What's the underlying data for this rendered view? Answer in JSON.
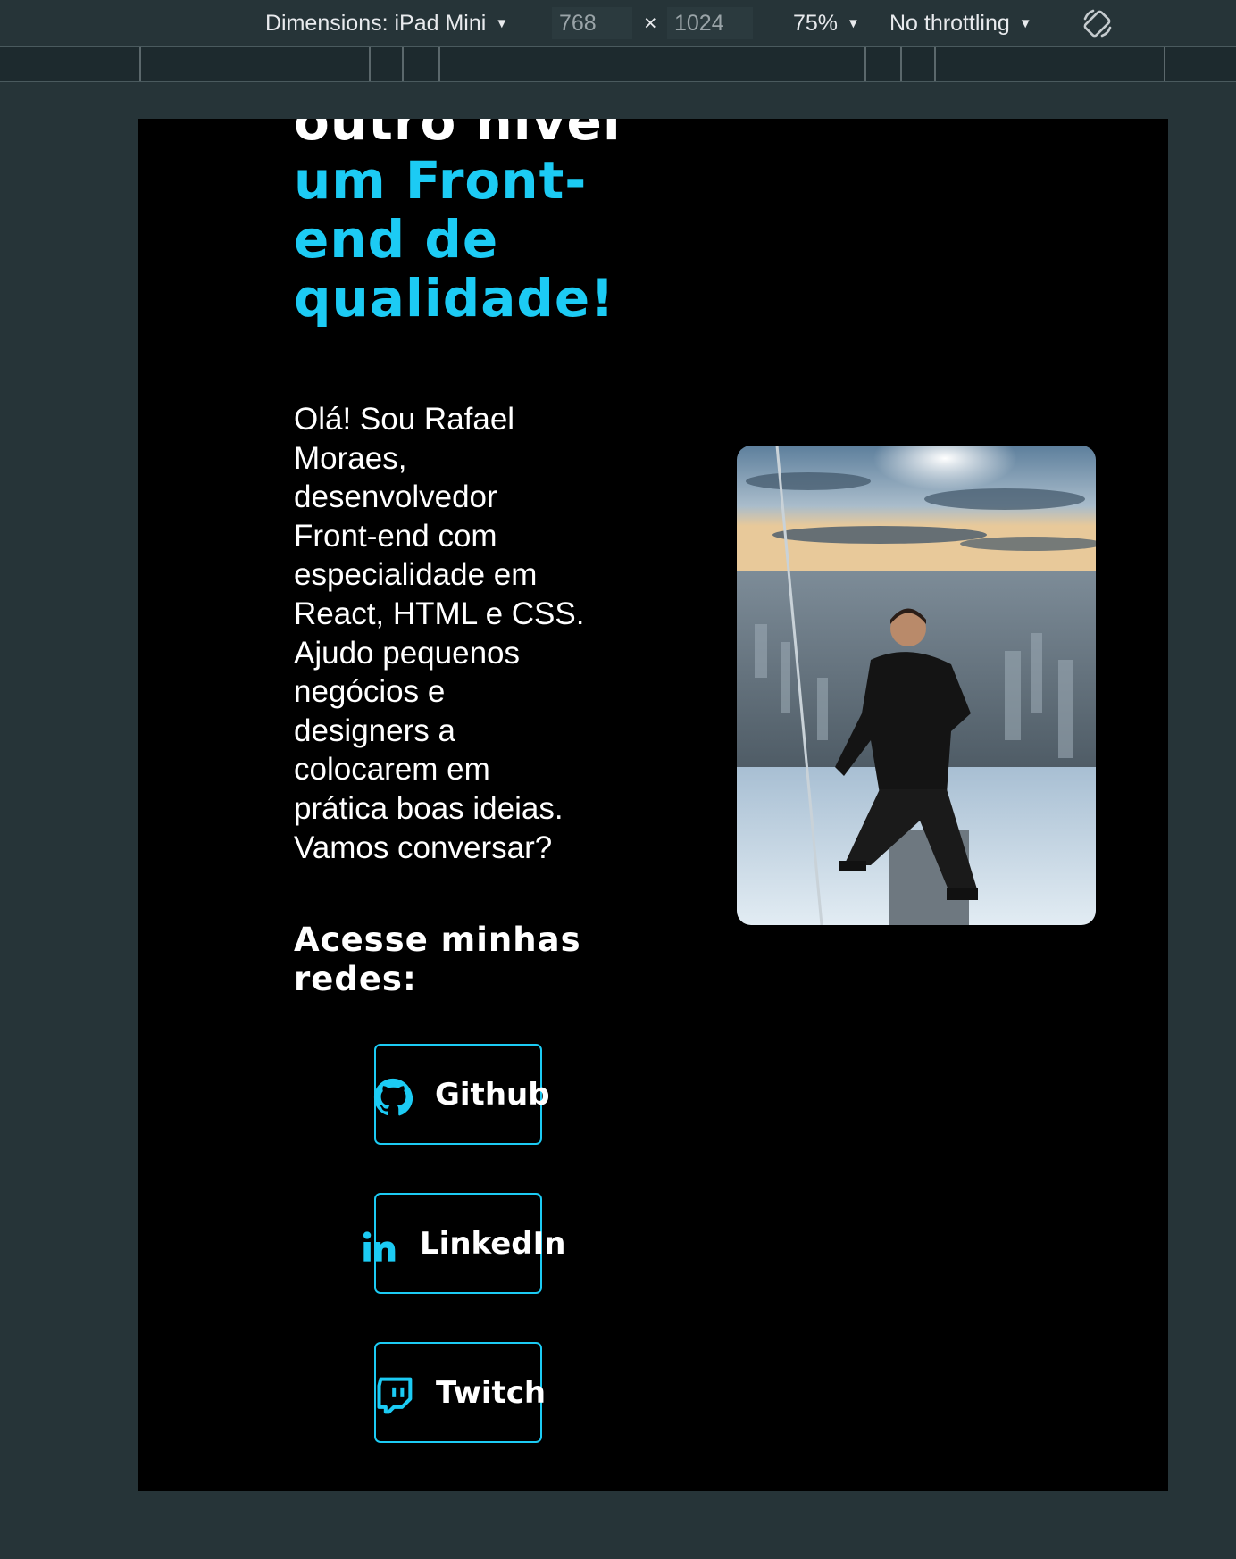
{
  "devtools": {
    "dimensions_label": "Dimensions: iPad Mini",
    "width_value": "768",
    "times_symbol": "×",
    "height_value": "1024",
    "zoom": "75%",
    "throttling": "No throttling",
    "caret": "▼",
    "rotate_icon": "rotate-device-icon"
  },
  "hero": {
    "heading_line_white": "outro nível",
    "heading_cyan_lines": [
      "um Front-",
      "end de",
      "qualidade!"
    ],
    "intro_lines": [
      "Olá! Sou Rafael",
      "Moraes,",
      "desenvolvedor",
      "Front-end com",
      "especialidade em",
      "React, HTML e CSS.",
      "Ajudo pequenos",
      "negócios e",
      "designers a",
      "colocarem em",
      "prática boas ideias.",
      "Vamos conversar?"
    ],
    "socials_title_lines": [
      "Acesse minhas",
      "redes:"
    ],
    "photo": "profile-photo"
  },
  "socials": [
    {
      "label": "Github",
      "icon": "github-icon"
    },
    {
      "label": "LinkedIn",
      "icon": "linkedin-icon"
    },
    {
      "label": "Twitch",
      "icon": "twitch-icon"
    }
  ],
  "colors": {
    "accent": "#1ccbf4",
    "page_bg": "#000000",
    "devtools_bg": "#263438",
    "text": "#ffffff"
  }
}
